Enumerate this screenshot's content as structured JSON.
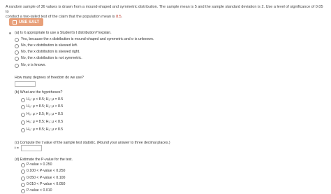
{
  "intro": {
    "line1": "A random sample of 36 values is drawn from a mound-shaped and symmetric distribution. The sample mean is 5 and the sample standard deviation is 2. Use a level of significance of 0.05 to",
    "line2_pre": "conduct a two-tailed test of the claim that the population mean is ",
    "line2_value": "8.5",
    "line2_post": "."
  },
  "salt_label": "USE SALT",
  "part_a": {
    "question": "(a) Is it appropriate to use a Student's t distribution? Explain.",
    "options": [
      "Yes, because the x distribution is mound-shaped and symmetric and σ is unknown.",
      "No, the x distribution is skewed left.",
      "No, the x distribution is skewed right.",
      "No, the x distribution is not symmetric.",
      "No, σ is known."
    ],
    "df_question": "How many degrees of freedom do we use?"
  },
  "part_b": {
    "question": "(b) What are the hypotheses?",
    "options": [
      "H₀: μ < 8.5; H₁: μ = 8.5",
      "H₀: μ = 8.5; H₁: μ > 8.5",
      "H₀: μ > 8.5; H₁: μ = 8.5",
      "H₀: μ = 8.5; H₁: μ < 8.5",
      "H₀: μ = 8.5; H₁: μ ≠ 8.5"
    ]
  },
  "part_c": {
    "question": "(c) Compute the t value of the sample test statistic. (Round your answer to three decimal places.)",
    "t_label": "t ="
  },
  "part_d": {
    "question": "(d) Estimate the P-value for the test.",
    "options": [
      "P-value > 0.250",
      "0.100 < P-value < 0.250",
      "0.050 < P-value < 0.100",
      "0.010 < P-value < 0.050",
      "P-value < 0.010"
    ]
  }
}
